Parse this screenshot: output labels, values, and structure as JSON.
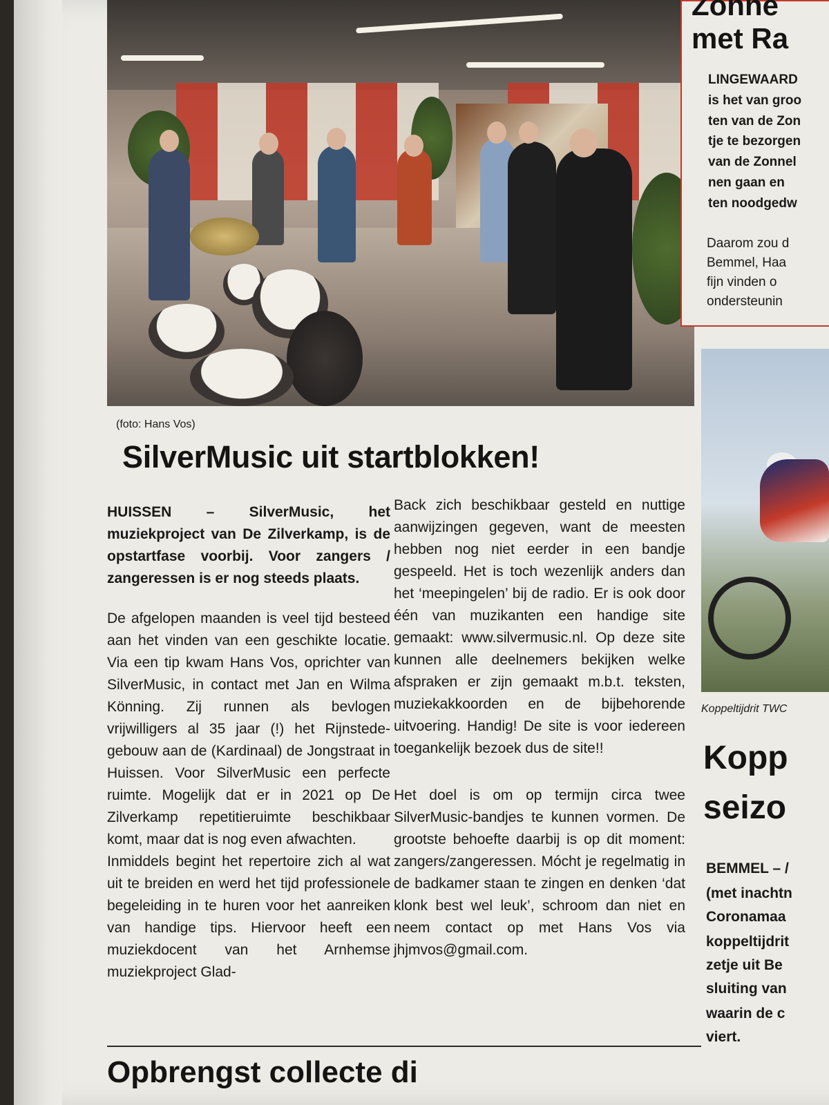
{
  "photo": {
    "caption": "(foto: Hans Vos)"
  },
  "article": {
    "headline": "SilverMusic uit startblokken!",
    "lead": "HUISSEN – SilverMusic, het muziekproject van De Zilverkamp, is de opstartfase voorbij. Voor zangers / zangeressen is er nog steeds plaats.",
    "col1_p1": "De afgelopen maanden is veel tijd besteed aan het vinden van een geschikte locatie. Via een tip kwam Hans Vos, oprichter van SilverMusic, in contact met Jan en Wilma Könning. Zij runnen als bevlogen vrijwilligers al 35 jaar (!) het Rijnstede-gebouw aan de (Kardinaal) de Jongstraat in Huissen. Voor SilverMusic een perfecte ruimte. Mogelijk dat er in 2021 op De Zilverkamp repetitieruimte beschikbaar komt, maar dat is nog even afwachten.",
    "col1_p2": "Inmiddels begint het repertoire zich al wat uit te breiden en werd het tijd professionele begeleiding in te huren voor het aanreiken van handige tips. Hiervoor heeft een muziekdocent van het Arnhemse muziekproject Glad-",
    "col2_p1": "Back zich beschikbaar gesteld en nuttige aanwijzingen gegeven, want de meesten hebben nog niet eerder in een bandje gespeeld. Het is toch wezenlijk anders dan het ‘meepingelen’ bij de radio. Er is ook door één van muzikanten een handige site gemaakt: www.silvermusic.nl. Op deze site kunnen alle deelnemers bekijken welke afspraken er zijn gemaakt m.b.t. teksten, muziekakkoorden en de bijbehorende uitvoering. Handig! De site is voor iedereen toegankelijk bezoek dus de site!!",
    "col2_p2": "Het doel is om op termijn circa twee SilverMusic-bandjes te kunnen vormen. De grootste behoefte daarbij is op dit moment: zangers/zangeressen. Mócht je regelmatig in de badkamer staan te zingen en denken ‘dat klonk best wel leuk’, schroom dan niet en neem contact op met Hans Vos via jhjmvos@gmail.com."
  },
  "next_article": {
    "headline": "Opbrengst collecte di"
  },
  "right_box": {
    "title_top": "Zonne",
    "title": "met Ra",
    "bold_lines": [
      "LINGEWAARD",
      "is het van groo",
      "ten van de Zon",
      "tje te bezorgen",
      "van de Zonnel",
      "nen gaan en",
      "ten noodgedw"
    ],
    "lines": [
      "Daarom zou d",
      "Bemmel, Haa",
      "fijn vinden o",
      "ondersteunin"
    ]
  },
  "right_article": {
    "caption": "Koppeltijdrit TWC",
    "headline_lines": [
      "Kopp",
      "seizo"
    ],
    "bold_lines": [
      "BEMMEL – /",
      "(met inachtn",
      "Coronamaa",
      "koppeltijdrit",
      "zetje uit Be",
      "sluiting van",
      "waarin de c",
      "viert."
    ]
  }
}
